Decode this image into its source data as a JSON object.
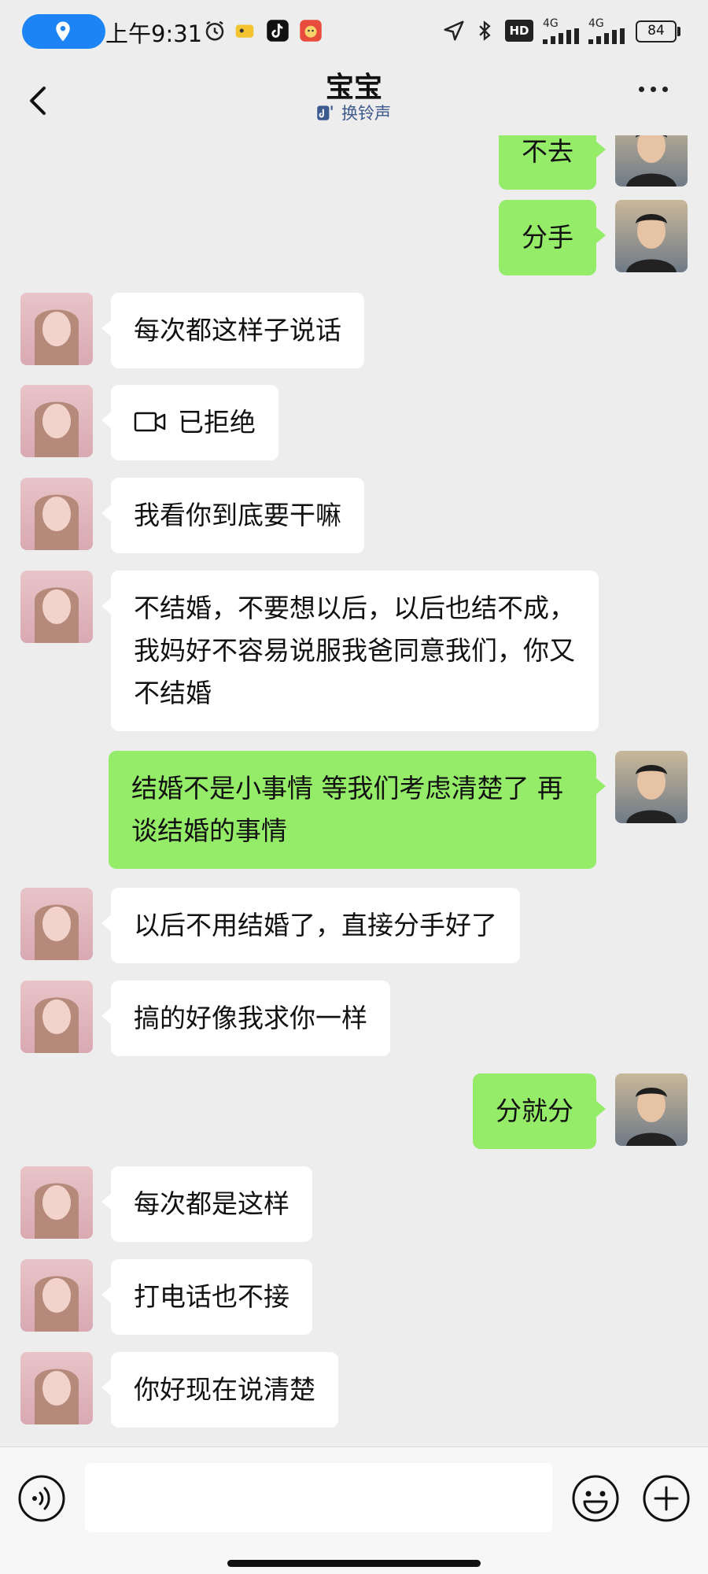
{
  "status_bar": {
    "time": "上午9:31",
    "network_1": "4G",
    "network_2": "4G",
    "hd_badge": "HD",
    "battery": "84"
  },
  "header": {
    "title": "宝宝",
    "subtitle": "换铃声"
  },
  "messages": [
    {
      "side": "out",
      "text": "不去"
    },
    {
      "side": "out",
      "text": "分手"
    },
    {
      "side": "in",
      "text": "每次都这样子说话"
    },
    {
      "side": "in",
      "text": "已拒绝",
      "icon": "video-call-icon"
    },
    {
      "side": "in",
      "text": "我看你到底要干嘛"
    },
    {
      "side": "in",
      "text": "不结婚，不要想以后，以后也结不成，我妈好不容易说服我爸同意我们，你又不结婚"
    },
    {
      "side": "out",
      "text": "结婚不是小事情 等我们考虑清楚了  再谈结婚的事情"
    },
    {
      "side": "in",
      "text": "以后不用结婚了，直接分手好了"
    },
    {
      "side": "in",
      "text": "搞的好像我求你一样"
    },
    {
      "side": "out",
      "text": "分就分"
    },
    {
      "side": "in",
      "text": "每次都是这样"
    },
    {
      "side": "in",
      "text": "打电话也不接"
    },
    {
      "side": "in",
      "text": "你好现在说清楚"
    }
  ],
  "input_bar": {
    "value": ""
  },
  "colors": {
    "outgoing_bubble": "#95ec69",
    "incoming_bubble": "#ffffff",
    "background": "#ededed",
    "location_pill": "#1d84f5"
  }
}
